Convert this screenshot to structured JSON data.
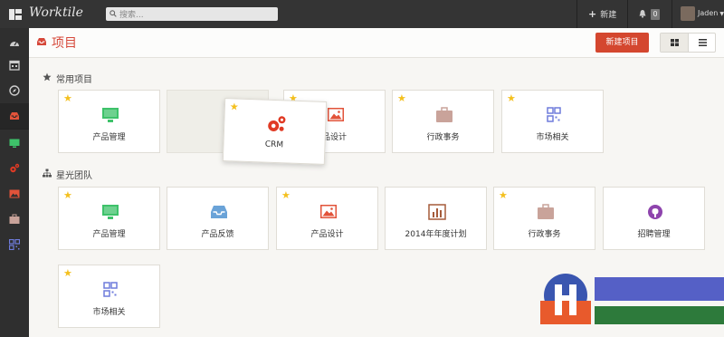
{
  "app": {
    "brand": "Worktile"
  },
  "topbar": {
    "search_placeholder": "搜索...",
    "new_label": "新建",
    "notification_count": "0",
    "user_name": "Jaden"
  },
  "sidebar": {
    "items": [
      {
        "name": "dashboard"
      },
      {
        "name": "calendar"
      },
      {
        "name": "explore"
      },
      {
        "name": "projects",
        "active": true
      },
      {
        "name": "monitor"
      },
      {
        "name": "gears"
      },
      {
        "name": "image"
      },
      {
        "name": "briefcase"
      },
      {
        "name": "qrcode"
      }
    ]
  },
  "header": {
    "title": "项目",
    "new_project_label": "新建项目"
  },
  "sections": {
    "favorites": {
      "title": "常用项目",
      "cards": [
        {
          "label": "产品管理",
          "icon": "monitor-icon",
          "starred": true
        },
        {
          "label": "品设计",
          "icon": "image-icon",
          "starred": true
        },
        {
          "label": "行政事务",
          "icon": "briefcase-icon",
          "starred": true
        },
        {
          "label": "市场相关",
          "icon": "qrcode-icon",
          "starred": true
        }
      ],
      "dragging": {
        "label": "CRM",
        "icon": "gears-icon",
        "starred": true
      }
    },
    "team": {
      "title": "星光团队",
      "cards": [
        {
          "label": "产品管理",
          "icon": "monitor-icon",
          "starred": true
        },
        {
          "label": "产品反馈",
          "icon": "inbox-icon",
          "starred": false
        },
        {
          "label": "产品设计",
          "icon": "image-icon",
          "starred": true
        },
        {
          "label": "2014年年度计划",
          "icon": "bar-chart-icon",
          "starred": false
        },
        {
          "label": "行政事务",
          "icon": "briefcase-icon",
          "starred": true
        },
        {
          "label": "招聘管理",
          "icon": "github-icon",
          "starred": false
        },
        {
          "label": "市场相关",
          "icon": "qrcode-icon",
          "starred": true
        }
      ]
    }
  },
  "colors": {
    "topbar": "#343434",
    "sidebar": "#2f2f2f",
    "accent_red": "#d4472f",
    "star": "#f4c01e",
    "monitor_green": "#3ec26a",
    "gear_red": "#e03a24",
    "image_red": "#e2533a",
    "briefcase_tan": "#c9a39a",
    "qr_blue": "#6f7cdc",
    "inbox_blue": "#6aa3d8",
    "chart_brown": "#a55b3a",
    "github_purple": "#8e44ad"
  }
}
